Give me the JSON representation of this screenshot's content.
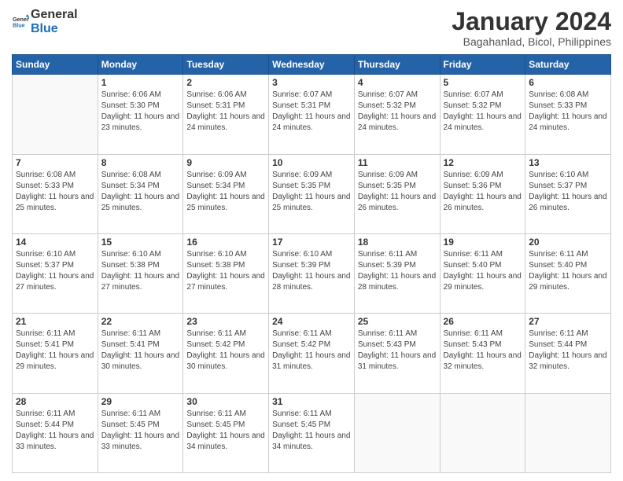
{
  "logo": {
    "line1": "General",
    "line2": "Blue"
  },
  "title": "January 2024",
  "subtitle": "Bagahanlad, Bicol, Philippines",
  "days_of_week": [
    "Sunday",
    "Monday",
    "Tuesday",
    "Wednesday",
    "Thursday",
    "Friday",
    "Saturday"
  ],
  "weeks": [
    [
      {
        "day": "",
        "sunrise": "",
        "sunset": "",
        "daylight": ""
      },
      {
        "day": "1",
        "sunrise": "6:06 AM",
        "sunset": "5:30 PM",
        "daylight": "11 hours and 23 minutes."
      },
      {
        "day": "2",
        "sunrise": "6:06 AM",
        "sunset": "5:31 PM",
        "daylight": "11 hours and 24 minutes."
      },
      {
        "day": "3",
        "sunrise": "6:07 AM",
        "sunset": "5:31 PM",
        "daylight": "11 hours and 24 minutes."
      },
      {
        "day": "4",
        "sunrise": "6:07 AM",
        "sunset": "5:32 PM",
        "daylight": "11 hours and 24 minutes."
      },
      {
        "day": "5",
        "sunrise": "6:07 AM",
        "sunset": "5:32 PM",
        "daylight": "11 hours and 24 minutes."
      },
      {
        "day": "6",
        "sunrise": "6:08 AM",
        "sunset": "5:33 PM",
        "daylight": "11 hours and 24 minutes."
      }
    ],
    [
      {
        "day": "7",
        "sunrise": "6:08 AM",
        "sunset": "5:33 PM",
        "daylight": "11 hours and 25 minutes."
      },
      {
        "day": "8",
        "sunrise": "6:08 AM",
        "sunset": "5:34 PM",
        "daylight": "11 hours and 25 minutes."
      },
      {
        "day": "9",
        "sunrise": "6:09 AM",
        "sunset": "5:34 PM",
        "daylight": "11 hours and 25 minutes."
      },
      {
        "day": "10",
        "sunrise": "6:09 AM",
        "sunset": "5:35 PM",
        "daylight": "11 hours and 25 minutes."
      },
      {
        "day": "11",
        "sunrise": "6:09 AM",
        "sunset": "5:35 PM",
        "daylight": "11 hours and 26 minutes."
      },
      {
        "day": "12",
        "sunrise": "6:09 AM",
        "sunset": "5:36 PM",
        "daylight": "11 hours and 26 minutes."
      },
      {
        "day": "13",
        "sunrise": "6:10 AM",
        "sunset": "5:37 PM",
        "daylight": "11 hours and 26 minutes."
      }
    ],
    [
      {
        "day": "14",
        "sunrise": "6:10 AM",
        "sunset": "5:37 PM",
        "daylight": "11 hours and 27 minutes."
      },
      {
        "day": "15",
        "sunrise": "6:10 AM",
        "sunset": "5:38 PM",
        "daylight": "11 hours and 27 minutes."
      },
      {
        "day": "16",
        "sunrise": "6:10 AM",
        "sunset": "5:38 PM",
        "daylight": "11 hours and 27 minutes."
      },
      {
        "day": "17",
        "sunrise": "6:10 AM",
        "sunset": "5:39 PM",
        "daylight": "11 hours and 28 minutes."
      },
      {
        "day": "18",
        "sunrise": "6:11 AM",
        "sunset": "5:39 PM",
        "daylight": "11 hours and 28 minutes."
      },
      {
        "day": "19",
        "sunrise": "6:11 AM",
        "sunset": "5:40 PM",
        "daylight": "11 hours and 29 minutes."
      },
      {
        "day": "20",
        "sunrise": "6:11 AM",
        "sunset": "5:40 PM",
        "daylight": "11 hours and 29 minutes."
      }
    ],
    [
      {
        "day": "21",
        "sunrise": "6:11 AM",
        "sunset": "5:41 PM",
        "daylight": "11 hours and 29 minutes."
      },
      {
        "day": "22",
        "sunrise": "6:11 AM",
        "sunset": "5:41 PM",
        "daylight": "11 hours and 30 minutes."
      },
      {
        "day": "23",
        "sunrise": "6:11 AM",
        "sunset": "5:42 PM",
        "daylight": "11 hours and 30 minutes."
      },
      {
        "day": "24",
        "sunrise": "6:11 AM",
        "sunset": "5:42 PM",
        "daylight": "11 hours and 31 minutes."
      },
      {
        "day": "25",
        "sunrise": "6:11 AM",
        "sunset": "5:43 PM",
        "daylight": "11 hours and 31 minutes."
      },
      {
        "day": "26",
        "sunrise": "6:11 AM",
        "sunset": "5:43 PM",
        "daylight": "11 hours and 32 minutes."
      },
      {
        "day": "27",
        "sunrise": "6:11 AM",
        "sunset": "5:44 PM",
        "daylight": "11 hours and 32 minutes."
      }
    ],
    [
      {
        "day": "28",
        "sunrise": "6:11 AM",
        "sunset": "5:44 PM",
        "daylight": "11 hours and 33 minutes."
      },
      {
        "day": "29",
        "sunrise": "6:11 AM",
        "sunset": "5:45 PM",
        "daylight": "11 hours and 33 minutes."
      },
      {
        "day": "30",
        "sunrise": "6:11 AM",
        "sunset": "5:45 PM",
        "daylight": "11 hours and 34 minutes."
      },
      {
        "day": "31",
        "sunrise": "6:11 AM",
        "sunset": "5:45 PM",
        "daylight": "11 hours and 34 minutes."
      },
      {
        "day": "",
        "sunrise": "",
        "sunset": "",
        "daylight": ""
      },
      {
        "day": "",
        "sunrise": "",
        "sunset": "",
        "daylight": ""
      },
      {
        "day": "",
        "sunrise": "",
        "sunset": "",
        "daylight": ""
      }
    ]
  ],
  "labels": {
    "sunrise_prefix": "Sunrise: ",
    "sunset_prefix": "Sunset: ",
    "daylight_prefix": "Daylight: "
  }
}
